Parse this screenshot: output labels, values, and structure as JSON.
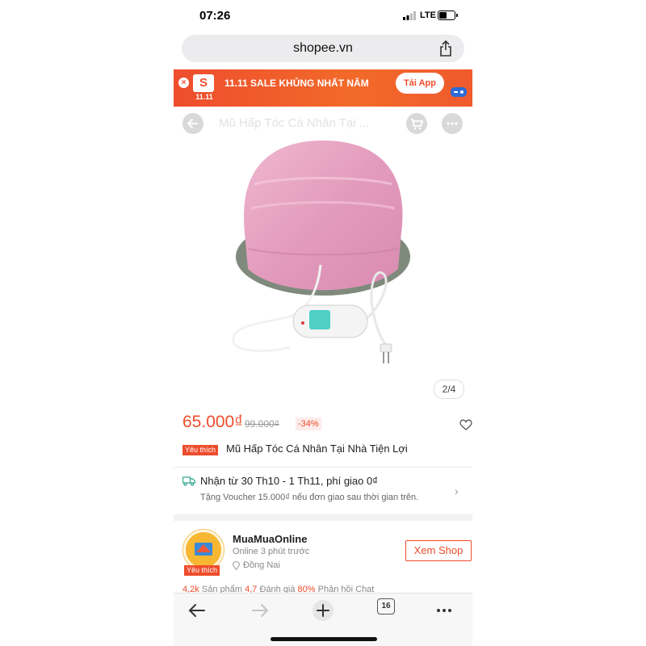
{
  "status_bar": {
    "time": "07:26",
    "network": "LTE"
  },
  "browser": {
    "url": "shopee.vn",
    "tab_count": "16"
  },
  "banner": {
    "logo_letter": "S",
    "logo_date": "11.11",
    "text": "11.11 SALE KHỦNG NHẤT NĂM",
    "button": "Tải App",
    "close": "×"
  },
  "product_nav": {
    "title": "Mũ Hấp Tóc Cá Nhân Tại ..."
  },
  "gallery": {
    "pager": "2/4"
  },
  "product": {
    "price": "65.000₫",
    "old_price": "99.000₫",
    "discount": "-34%",
    "badge": "Yêu thích",
    "name": "Mũ Hấp Tóc Cá Nhân Tại Nhà Tiện Lợi"
  },
  "shipping": {
    "line1": "Nhận từ 30 Th10 - 1 Th11, phí giao 0₫",
    "line2": "Tặng Voucher 15.000₫ nếu đơn giao sau thời gian trên."
  },
  "shop": {
    "name": "MuaMuaOnline",
    "online": "Online 3 phút trước",
    "location": "Đồng Nai",
    "badge": "Yêu thích",
    "button": "Xem Shop"
  },
  "stats": {
    "products_value": "4,2k",
    "products_label": "Sản phẩm",
    "rating_value": "4,7",
    "rating_label": "Đánh giá",
    "chat_value": "80%",
    "chat_label": "Phản hồi Chat"
  },
  "colors": {
    "brand": "#ee4d2d",
    "cap": "#e6a6c2"
  }
}
